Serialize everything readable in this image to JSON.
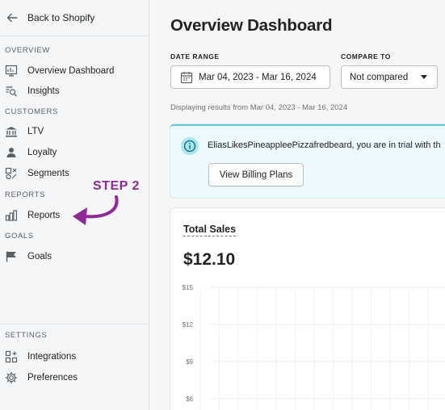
{
  "sidebar": {
    "back_label": "Back to Shopify",
    "sections": {
      "overview": "OVERVIEW",
      "customers": "CUSTOMERS",
      "reports": "REPORTS",
      "goals": "GOALS",
      "settings": "SETTINGS"
    },
    "items": {
      "overview_dashboard": "Overview Dashboard",
      "insights": "Insights",
      "ltv": "LTV",
      "loyalty": "Loyalty",
      "segments": "Segments",
      "reports": "Reports",
      "goals": "Goals",
      "integrations": "Integrations",
      "preferences": "Preferences"
    }
  },
  "annotation": {
    "step_label": "STEP 2",
    "color": "#8e2a97"
  },
  "main": {
    "title": "Overview Dashboard",
    "date_range_label": "DATE RANGE",
    "date_range_value": "Mar 04, 2023 - Mar 16, 2024",
    "compare_label": "COMPARE TO",
    "compare_value": "Not compared",
    "displaying_text": "Displaying results from Mar 04, 2023 - Mar 16, 2024",
    "banner": {
      "message": "EliasLikesPineappleePizzafredbeard, you are in trial with th",
      "button_label": "View Billing Plans"
    },
    "total_sales": {
      "title": "Total Sales",
      "value": "$12.10",
      "y_ticks": [
        "$15",
        "$12",
        "$9",
        "$6"
      ]
    }
  },
  "colors": {
    "accent_teal": "#62c6cd",
    "banner_bg": "#ebf9fc"
  }
}
